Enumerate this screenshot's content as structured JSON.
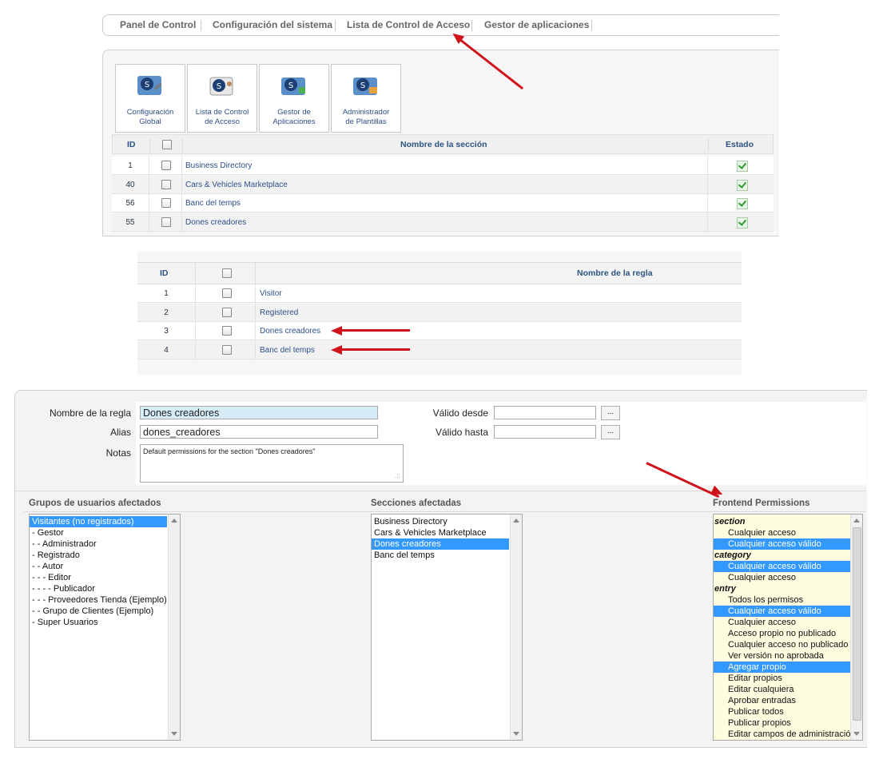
{
  "nav": {
    "items": [
      "Panel de Control",
      "Configuración del sistema",
      "Lista de Control de Acceso",
      "Gestor de aplicaciones"
    ]
  },
  "tiles": [
    {
      "line1": "Configuración",
      "line2": "Global"
    },
    {
      "line1": "Lista de Control",
      "line2": "de Acceso"
    },
    {
      "line1": "Gestor de",
      "line2": "Aplicaciones"
    },
    {
      "line1": "Administrador",
      "line2": "de Plantillas"
    }
  ],
  "sections_table": {
    "headers": {
      "id": "ID",
      "name": "Nombre de la sección",
      "state": "Estado"
    },
    "rows": [
      {
        "id": "1",
        "name": "Business Directory"
      },
      {
        "id": "40",
        "name": "Cars & Vehicles Marketplace"
      },
      {
        "id": "56",
        "name": "Banc del temps"
      },
      {
        "id": "55",
        "name": "Dones creadores"
      }
    ]
  },
  "rules_table": {
    "headers": {
      "id": "ID",
      "name": "Nombre de la regla"
    },
    "rows": [
      {
        "id": "1",
        "name": "Visitor"
      },
      {
        "id": "2",
        "name": "Registered"
      },
      {
        "id": "3",
        "name": "Dones creadores"
      },
      {
        "id": "4",
        "name": "Banc del temps"
      }
    ]
  },
  "form": {
    "rule_name_label": "Nombre de la regla",
    "rule_name_value": "Dones creadores",
    "alias_label": "Alias",
    "alias_value": "dones_creadores",
    "notes_label": "Notas",
    "notes_value": "Default permissions for the section \"Dones creadores\"",
    "valid_from_label": "Válido desde",
    "valid_from_value": "",
    "valid_to_label": "Válido hasta",
    "valid_to_value": "",
    "picker_label": "..."
  },
  "groups": {
    "title": "Grupos de usuarios afectados",
    "items": [
      "Visitantes (no registrados)",
      "- Gestor",
      "- - Administrador",
      "- Registrado",
      "- - Autor",
      "- - - Editor",
      "- - - - Publicador",
      "- - - Proveedores Tienda (Ejemplo)",
      "- - Grupo de Clientes (Ejemplo)",
      "- Super Usuarios"
    ],
    "selected": [
      0
    ]
  },
  "sections_affected": {
    "title": "Secciones afectadas",
    "items": [
      "Business Directory",
      "Cars & Vehicles Marketplace",
      "Dones creadores",
      "Banc del temps"
    ],
    "selected": [
      2
    ]
  },
  "permissions": {
    "title": "Frontend Permissions",
    "items": [
      {
        "text": "section",
        "group": true
      },
      {
        "text": "Cualquier acceso"
      },
      {
        "text": "Cualquier acceso válido",
        "selected": true
      },
      {
        "text": "category",
        "group": true
      },
      {
        "text": "Cualquier acceso válido",
        "selected": true
      },
      {
        "text": "Cualquier acceso"
      },
      {
        "text": "entry",
        "group": true
      },
      {
        "text": "Todos los permisos"
      },
      {
        "text": "Cualquier acceso válido",
        "selected": true
      },
      {
        "text": "Cualquier acceso"
      },
      {
        "text": "Acceso propio no publicado"
      },
      {
        "text": "Cualquier acceso no publicado"
      },
      {
        "text": "Ver versión no aprobada"
      },
      {
        "text": "Agregar propio",
        "selected": true
      },
      {
        "text": "Editar propios"
      },
      {
        "text": "Editar cualquiera"
      },
      {
        "text": "Aprobar entradas"
      },
      {
        "text": "Publicar todos"
      },
      {
        "text": "Publicar propios"
      },
      {
        "text": "Editar campos de administración"
      }
    ]
  },
  "colors": {
    "arrow": "#d0131b",
    "selection": "#3399ff",
    "link": "#2d4f87",
    "perm_bg": "#fffde0"
  }
}
